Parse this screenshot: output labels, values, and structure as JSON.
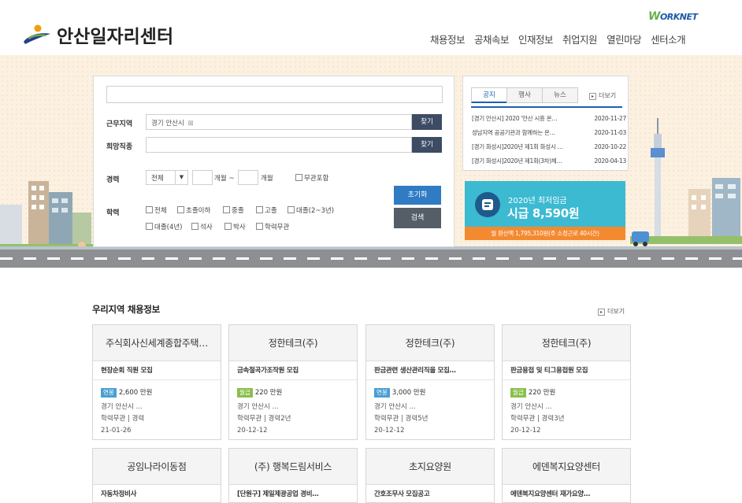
{
  "header": {
    "logo_text": "안산일자리센터",
    "worknet_w": "W",
    "worknet_rest": "ORKNET",
    "nav": [
      "채용정보",
      "공채속보",
      "인재정보",
      "취업지원",
      "열린마당",
      "센터소개"
    ]
  },
  "search": {
    "region_label": "근무지역",
    "region_value": "경기 안산시",
    "region_clear": "⊠",
    "find_label": "찾기",
    "job_label": "희망직종",
    "career_label": "경력",
    "career_select": "전체",
    "career_arrow": "▼",
    "month_unit_1": "개월 ~",
    "month_unit_2": "개월",
    "career_none": "무관포함",
    "edu_label": "학력",
    "edu_options_row1": [
      "전체",
      "초졸이하",
      "중졸",
      "고졸",
      "대졸(2~3년)"
    ],
    "edu_options_row2": [
      "대졸(4년)",
      "석사",
      "박사",
      "학력무관"
    ],
    "reset_label": "초기화",
    "search_label": "검색"
  },
  "notice": {
    "tabs": [
      "공지",
      "행사",
      "뉴스"
    ],
    "more": "더보기",
    "more_icon": "▸",
    "items": [
      {
        "title": "[경기 안산시] 2020 '안산 시흥 온…",
        "date": "2020-11-27"
      },
      {
        "title": "성남지역 공공기관과 함께하는 온…",
        "date": "2020-11-03"
      },
      {
        "title": "[경기 화성시]2020년 제1회 화성시 …",
        "date": "2020-10-22"
      },
      {
        "title": "[경기 화성시]2020년 제1회(3차)체…",
        "date": "2020-04-13"
      }
    ]
  },
  "wage": {
    "year_label": "2020년 최저임금",
    "amount": "시급 8,590원",
    "monthly": "월 환산액 1,795,310원(주 소정근로 40시간)"
  },
  "jobs": {
    "title": "우리지역 채용정보",
    "more": "더보기",
    "more_icon": "▸",
    "cards": [
      {
        "company": "주식회사신세계종합주택…",
        "title": "현장순회 직원 모집",
        "pay_type": "연봉",
        "pay_kind": "year",
        "pay": "2,600 만원",
        "location": "경기 안산시 ...",
        "req": "학력무관 | 경력",
        "date": "21-01-26"
      },
      {
        "company": "정한테크(주)",
        "title": "금속절곡가조작원 모집",
        "pay_type": "월급",
        "pay_kind": "month",
        "pay": "220 만원",
        "location": "경기 안산시 ...",
        "req": "학력무관 | 경력2년",
        "date": "20-12-12"
      },
      {
        "company": "정한테크(주)",
        "title": "판금관련 생산관리직을 모집…",
        "pay_type": "연봉",
        "pay_kind": "year",
        "pay": "3,000 만원",
        "location": "경기 안산시 ...",
        "req": "학력무관 | 경력5년",
        "date": "20-12-12"
      },
      {
        "company": "정한테크(주)",
        "title": "판금용접 및 티그용접원 모집",
        "pay_type": "월급",
        "pay_kind": "month",
        "pay": "220 만원",
        "location": "경기 안산시 ...",
        "req": "학력무관 | 경력3년",
        "date": "20-12-12"
      },
      {
        "company": "공임나라이동점",
        "title": "자동차정비사"
      },
      {
        "company": "(주) 행복드림서비스",
        "title": "[단원구] 제일제광공업 경비…"
      },
      {
        "company": "초지요양원",
        "title": "간호조무사 모집공고"
      },
      {
        "company": "에덴복지요양센터",
        "title": "에덴복지요양센터 재가요양…"
      }
    ]
  },
  "colors": {
    "primary_blue": "#2f7bc4",
    "dark_button": "#3d4b64",
    "wage_bg": "#3bbad2",
    "wage_bar": "#f48a2f",
    "hero_bg": "#fcf1e1"
  }
}
